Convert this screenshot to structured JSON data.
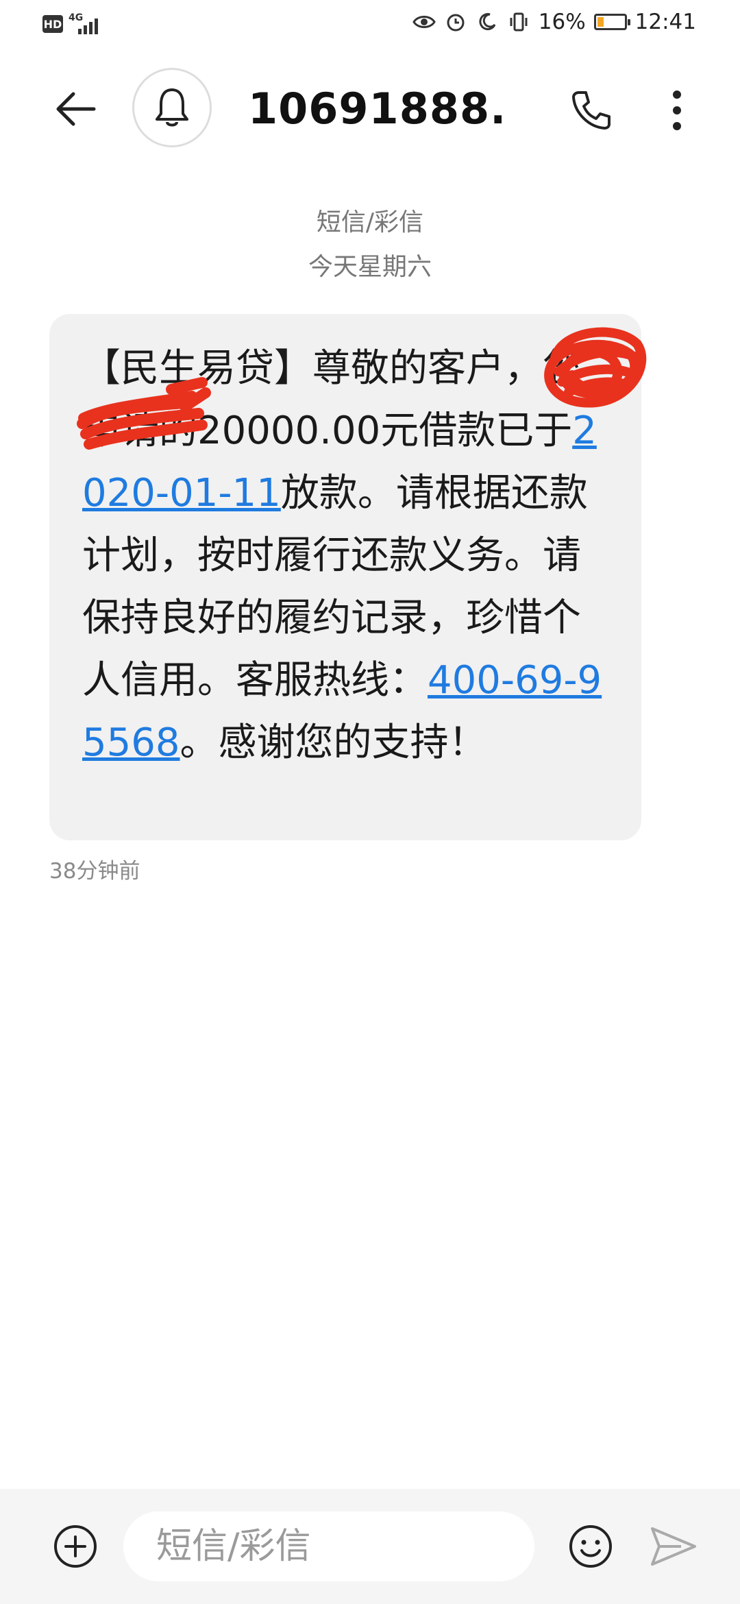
{
  "status_bar": {
    "hd": "HD",
    "network": "4G",
    "battery_percent": "16%",
    "battery_level": 0.16,
    "time": "12:41"
  },
  "header": {
    "title": "10691888..."
  },
  "conversation": {
    "type_label": "短信/彩信",
    "date_label": "今天星期六"
  },
  "message": {
    "part1": "【民生易贷】尊敬的客户",
    "part2": "，您申请的20000.00元借款已于",
    "date_link": "2020-01-11",
    "part3": "放款。请根据还款计划，按时履行还款义务。请保持良好的履约记录，珍惜个人信用。客服热线：",
    "phone_link": "400-69-95568",
    "part4": "。感谢您的支持！",
    "time": "38分钟前"
  },
  "input": {
    "placeholder": "短信/彩信"
  }
}
